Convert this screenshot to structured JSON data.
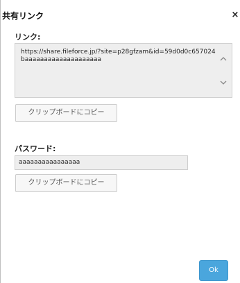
{
  "dialog": {
    "title": "共有リンク",
    "close_label": "×"
  },
  "link_section": {
    "label": "リンク:",
    "value": "https://share.fileforce.jp/?site=p28gfzam&id=59d0d0c657024baaaaaaaaaaaaaaaaaaaa",
    "copy_button_label": "クリップボードにコピー"
  },
  "password_section": {
    "label": "パスワード:",
    "value": "aaaaaaaaaaaaaaaa",
    "copy_button_label": "クリップボードにコピー"
  },
  "footer": {
    "ok_label": "Ok"
  },
  "icons": {
    "scroll_up": "chevron-up-icon",
    "scroll_down": "chevron-down-icon",
    "close": "close-icon"
  },
  "colors": {
    "ok_button": "#4aa6dd",
    "field_background": "#eeeeee"
  }
}
